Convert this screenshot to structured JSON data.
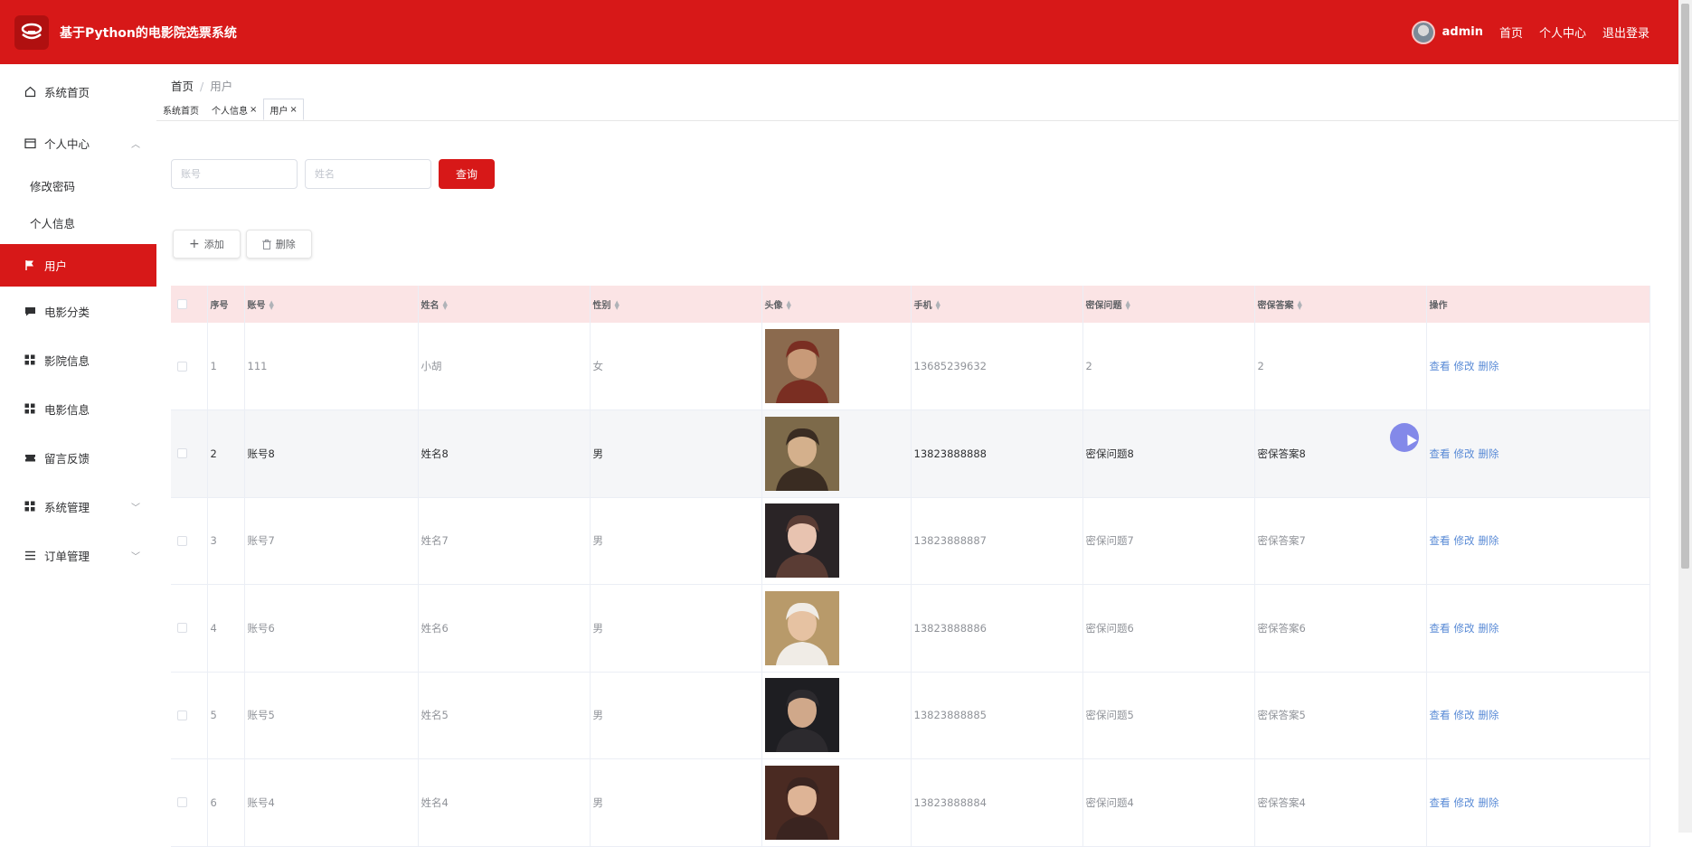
{
  "app": {
    "title": "基于Python的电影院选票系统"
  },
  "topnav": {
    "user": "admin",
    "home": "首页",
    "profile": "个人中心",
    "logout": "退出登录"
  },
  "sidebar": {
    "items": [
      {
        "label": "系统首页",
        "icon": "home-icon"
      },
      {
        "label": "个人中心",
        "icon": "calendar-icon",
        "expanded": true,
        "children": [
          {
            "label": "修改密码"
          },
          {
            "label": "个人信息"
          }
        ]
      },
      {
        "label": "用户",
        "icon": "flag-icon",
        "active": true
      },
      {
        "label": "电影分类",
        "icon": "chat-icon"
      },
      {
        "label": "影院信息",
        "icon": "grid-icon"
      },
      {
        "label": "电影信息",
        "icon": "grid-icon"
      },
      {
        "label": "留言反馈",
        "icon": "ticket-icon"
      },
      {
        "label": "系统管理",
        "icon": "grid-icon",
        "expanded": false
      },
      {
        "label": "订单管理",
        "icon": "list-icon",
        "expanded": false
      }
    ]
  },
  "breadcrumb": {
    "home": "首页",
    "current": "用户"
  },
  "tags": [
    {
      "label": "系统首页"
    },
    {
      "label": "个人信息",
      "closable": true
    },
    {
      "label": "用户",
      "closable": true,
      "active": true
    }
  ],
  "search": {
    "account_placeholder": "账号",
    "name_placeholder": "姓名",
    "query_label": "查询"
  },
  "toolbar": {
    "add_label": "添加",
    "delete_label": "删除"
  },
  "table": {
    "columns": [
      "序号",
      "账号",
      "姓名",
      "性别",
      "头像",
      "手机",
      "密保问题",
      "密保答案",
      "操作"
    ],
    "ops": {
      "view": "查看",
      "edit": "修改",
      "delete": "删除"
    },
    "rows": [
      {
        "index": "1",
        "account": "111",
        "name": "小胡",
        "gender": "女",
        "phone": "13685239632",
        "question": "2",
        "answer": "2",
        "photo_colors": [
          "#8b6a4e",
          "#c89a78",
          "#7a2e22"
        ]
      },
      {
        "index": "2",
        "account": "账号8",
        "name": "姓名8",
        "gender": "男",
        "phone": "13823888888",
        "question": "密保问题8",
        "answer": "密保答案8",
        "hover": true,
        "photo_colors": [
          "#7d6a4a",
          "#d4b08c",
          "#3a2c22"
        ]
      },
      {
        "index": "3",
        "account": "账号7",
        "name": "姓名7",
        "gender": "男",
        "phone": "13823888887",
        "question": "密保问题7",
        "answer": "密保答案7",
        "photo_colors": [
          "#2a2426",
          "#e8c3b0",
          "#5a3c34"
        ]
      },
      {
        "index": "4",
        "account": "账号6",
        "name": "姓名6",
        "gender": "男",
        "phone": "13823888886",
        "question": "密保问题6",
        "answer": "密保答案6",
        "photo_colors": [
          "#b89a6a",
          "#e6c2a2",
          "#f0ece6"
        ]
      },
      {
        "index": "5",
        "account": "账号5",
        "name": "姓名5",
        "gender": "男",
        "phone": "13823888885",
        "question": "密保问题5",
        "answer": "密保答案5",
        "photo_colors": [
          "#1e1e22",
          "#d0a88a",
          "#2c2a2e"
        ]
      },
      {
        "index": "6",
        "account": "账号4",
        "name": "姓名4",
        "gender": "男",
        "phone": "13823888884",
        "question": "密保问题4",
        "answer": "密保答案4",
        "photo_colors": [
          "#4a2a22",
          "#deb496",
          "#3a2420"
        ]
      }
    ]
  }
}
